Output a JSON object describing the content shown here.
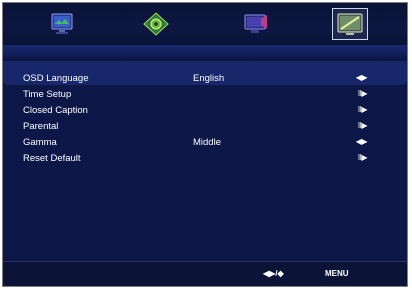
{
  "tabs": [
    {
      "icon": "picture-icon"
    },
    {
      "icon": "audio-icon"
    },
    {
      "icon": "channel-icon"
    },
    {
      "icon": "setup-icon",
      "active": true
    }
  ],
  "menu": {
    "items": [
      {
        "label": "OSD Language",
        "value": "English",
        "nav": "◀▶"
      },
      {
        "label": "Time Setup",
        "value": "",
        "nav": "II▶"
      },
      {
        "label": "Closed Caption",
        "value": "",
        "nav": "II▶"
      },
      {
        "label": "Parental",
        "value": "",
        "nav": "II▶"
      },
      {
        "label": "Gamma",
        "value": "Middle",
        "nav": "◀▶"
      },
      {
        "label": "Reset Default",
        "value": "",
        "nav": "II▶"
      }
    ]
  },
  "footer": {
    "nav_hint": "◀▶/◆",
    "menu_label": "MENU"
  },
  "colors": {
    "background": "#0e1a4c",
    "highlight": "#172769",
    "text": "#ffffff"
  }
}
